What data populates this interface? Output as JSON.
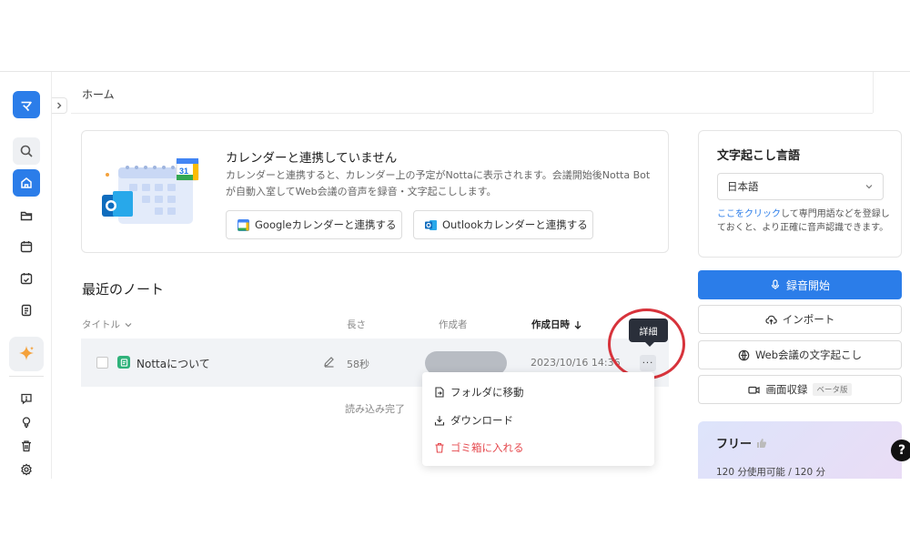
{
  "sidebar": {
    "logo": "マ",
    "items": [
      {
        "name": "search",
        "icon": "search-icon"
      },
      {
        "name": "home",
        "icon": "home-icon"
      },
      {
        "name": "folder",
        "icon": "folder-icon"
      },
      {
        "name": "calendar",
        "icon": "calendar-icon"
      },
      {
        "name": "schedule",
        "icon": "calendar-check-icon"
      },
      {
        "name": "notes",
        "icon": "clipboard-icon"
      },
      {
        "name": "ai",
        "icon": "sparkle-icon"
      },
      {
        "name": "feedback",
        "icon": "feedback-icon"
      },
      {
        "name": "tips",
        "icon": "lightbulb-icon"
      },
      {
        "name": "trash",
        "icon": "trash-icon"
      },
      {
        "name": "settings",
        "icon": "gear-icon"
      }
    ]
  },
  "header": {
    "breadcrumb": "ホーム"
  },
  "calendar_card": {
    "title": "カレンダーと連携していません",
    "description": "カレンダーと連携すると、カレンダー上の予定がNottaに表示されます。会議開始後Notta Botが自動入室してWeb会議の音声を録音・文字起こしします。",
    "google_button": "Googleカレンダーと連携する",
    "outlook_button": "Outlookカレンダーと連携する",
    "illustration_date": "31"
  },
  "recent": {
    "title": "最近のノート",
    "columns": {
      "title": "タイトル",
      "length": "長さ",
      "author": "作成者",
      "date": "作成日時"
    },
    "rows": [
      {
        "name": "Nottaについて",
        "length": "58秒",
        "date": "2023/10/16 14:36"
      }
    ],
    "loaded_text": "読み込み完了"
  },
  "tooltip": {
    "text": "詳細"
  },
  "more_label": "···",
  "context_menu": {
    "items": [
      {
        "label": "フォルダに移動",
        "icon": "folder-move-icon"
      },
      {
        "label": "ダウンロード",
        "icon": "download-icon"
      },
      {
        "label": "ゴミ箱に入れる",
        "icon": "trash-icon"
      }
    ]
  },
  "language_card": {
    "title": "文字起こし言語",
    "selected": "日本語",
    "hint_link": "ここをクリック",
    "hint_text": "して専門用語などを登録しておくと、より正確に音声認識できます。"
  },
  "actions": {
    "record": "録音開始",
    "import": "インポート",
    "web_meeting": "Web会議の文字起こし",
    "screen_record": "画面収録",
    "beta": "ベータ版"
  },
  "plan": {
    "name": "フリー",
    "usage": "120 分使用可能 / 120 分"
  },
  "help": "?",
  "colors": {
    "primary": "#2b7de9",
    "danger": "#e5484d",
    "highlight_circle": "#d7333b",
    "tooltip_bg": "#2a2f3a"
  }
}
